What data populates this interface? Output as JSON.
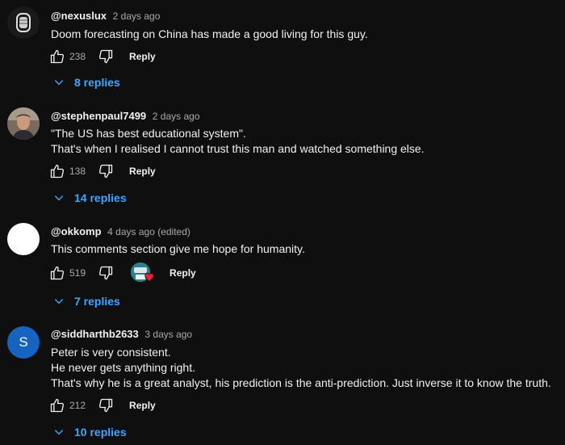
{
  "comments": [
    {
      "author": "@nexuslux",
      "time": "2 days ago",
      "avatar": "dark-logo-avatar",
      "lines": [
        "Doom forecasting on China has made a good living for this guy."
      ],
      "likes": "238",
      "reply_label": "Reply",
      "replies_label": "8 replies"
    },
    {
      "author": "@stephenpaul7499",
      "time": "2 days ago",
      "avatar": "photo-avatar",
      "lines": [
        "\"The US has best educational system\".",
        "That's when I realised I cannot trust this man and watched something else."
      ],
      "likes": "138",
      "reply_label": "Reply",
      "replies_label": "14 replies"
    },
    {
      "author": "@okkomp",
      "time": "4 days ago (edited)",
      "avatar": "white-avatar",
      "lines": [
        "This comments section give me hope for humanity."
      ],
      "likes": "519",
      "reply_label": "Reply",
      "replies_label": "7 replies",
      "creator_heart": true
    },
    {
      "author": "@siddharthb2633",
      "time": "3 days ago",
      "avatar_letter": "S",
      "avatar_color": "#1565c0",
      "lines": [
        "Peter is very consistent.",
        "He never gets anything right.",
        "That's why he is a great analyst, his prediction is the anti-prediction. Just inverse it to know the truth."
      ],
      "likes": "212",
      "reply_label": "Reply",
      "replies_label": "10 replies"
    }
  ],
  "colors": {
    "background": "#0f0f0f",
    "text": "#f1f1f1",
    "muted": "#aaaaaa",
    "link": "#3ea6ff",
    "heart": "#e91e3c"
  },
  "icons": [
    "thumbs-up-icon",
    "thumbs-down-icon",
    "chevron-down-icon",
    "heart-icon"
  ]
}
